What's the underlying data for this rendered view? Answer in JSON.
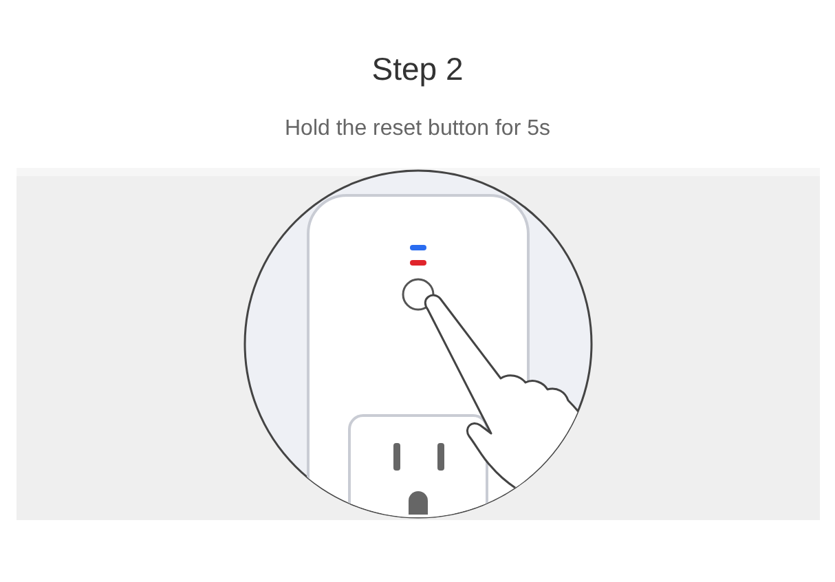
{
  "title": "Step 2",
  "instruction": "Hold the reset button for 5s"
}
